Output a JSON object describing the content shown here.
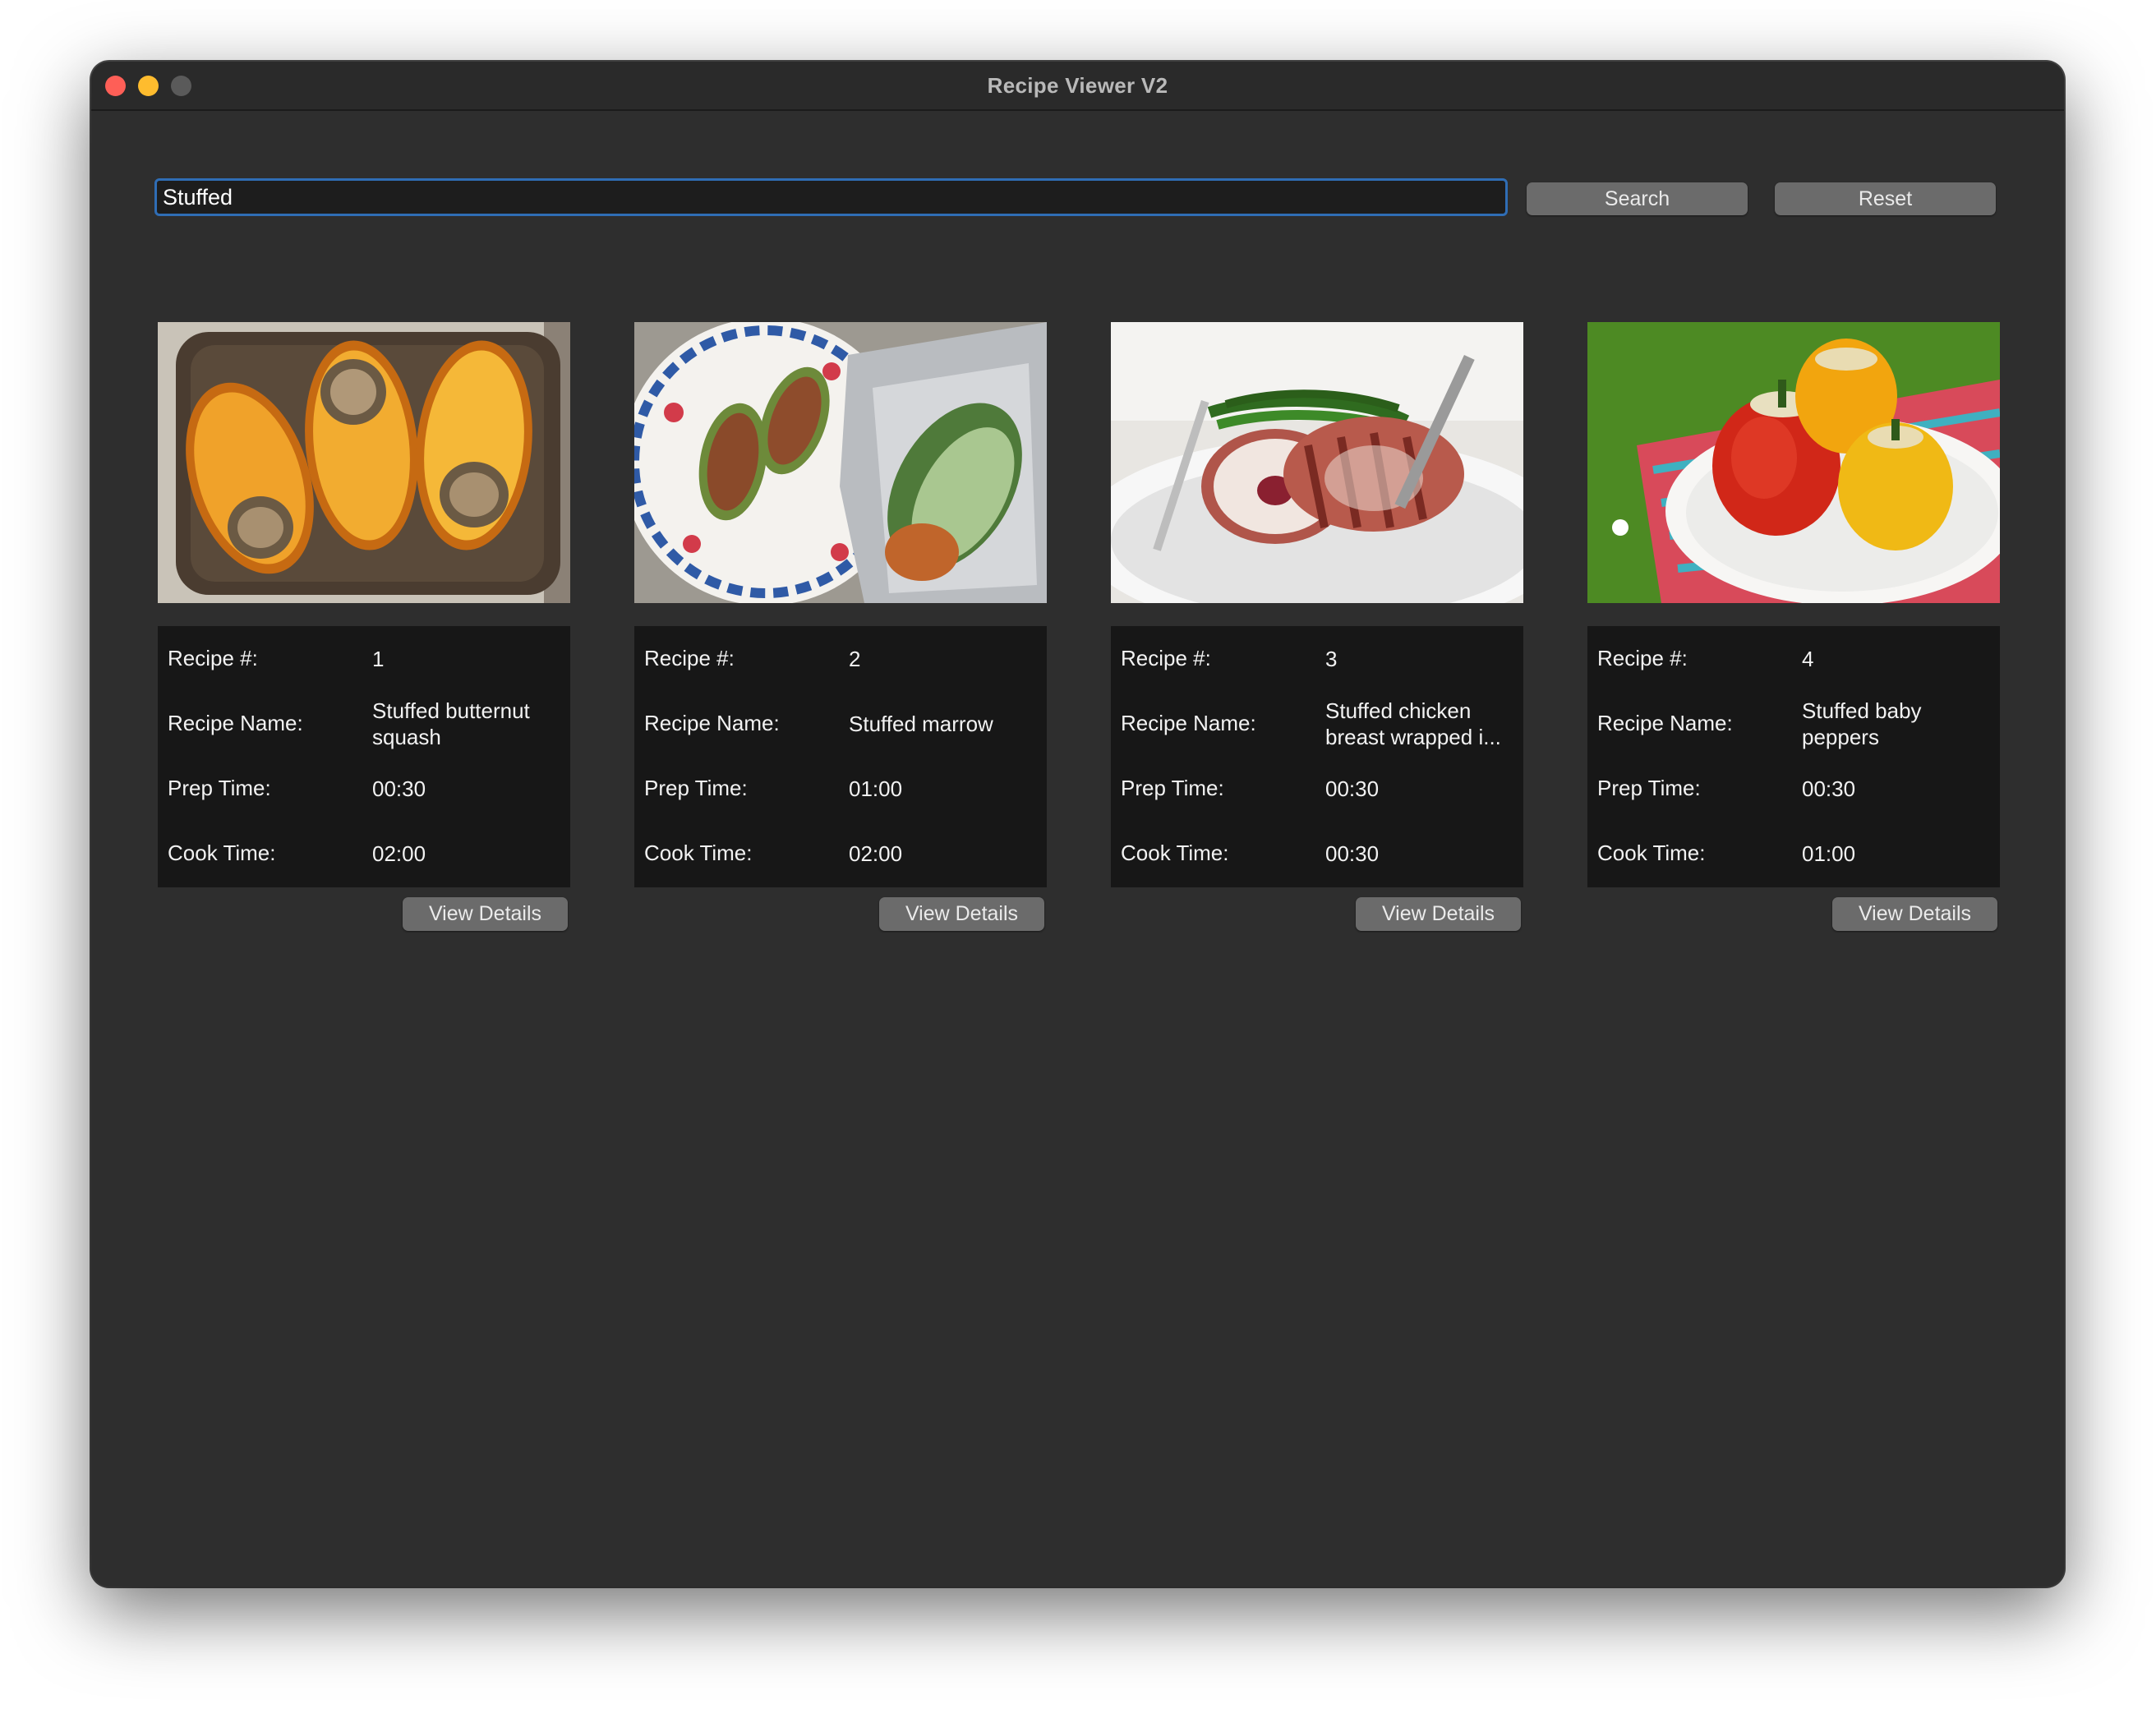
{
  "window": {
    "title": "Recipe Viewer V2"
  },
  "search": {
    "value": "Stuffed",
    "search_label": "Search",
    "reset_label": "Reset"
  },
  "labels": {
    "recipe_number": "Recipe #:",
    "recipe_name": "Recipe Name:",
    "prep_time": "Prep Time:",
    "cook_time": "Cook Time:",
    "view_details": "View Details"
  },
  "recipes": [
    {
      "number": "1",
      "name": "Stuffed butternut squash",
      "prep": "00:30",
      "cook": "02:00",
      "image": "butternut-squash-photo"
    },
    {
      "number": "2",
      "name": "Stuffed marrow",
      "prep": "01:00",
      "cook": "02:00",
      "image": "stuffed-marrow-photo"
    },
    {
      "number": "3",
      "name": "Stuffed chicken breast wrapped i...",
      "prep": "00:30",
      "cook": "00:30",
      "image": "stuffed-chicken-photo"
    },
    {
      "number": "4",
      "name": "Stuffed baby peppers",
      "prep": "00:30",
      "cook": "01:00",
      "image": "stuffed-peppers-photo"
    }
  ],
  "colors": {
    "window_bg": "#2e2e2e",
    "input_focus": "#2f6db5",
    "button_bg": "#6b6b6b",
    "info_bg": "#171717"
  }
}
